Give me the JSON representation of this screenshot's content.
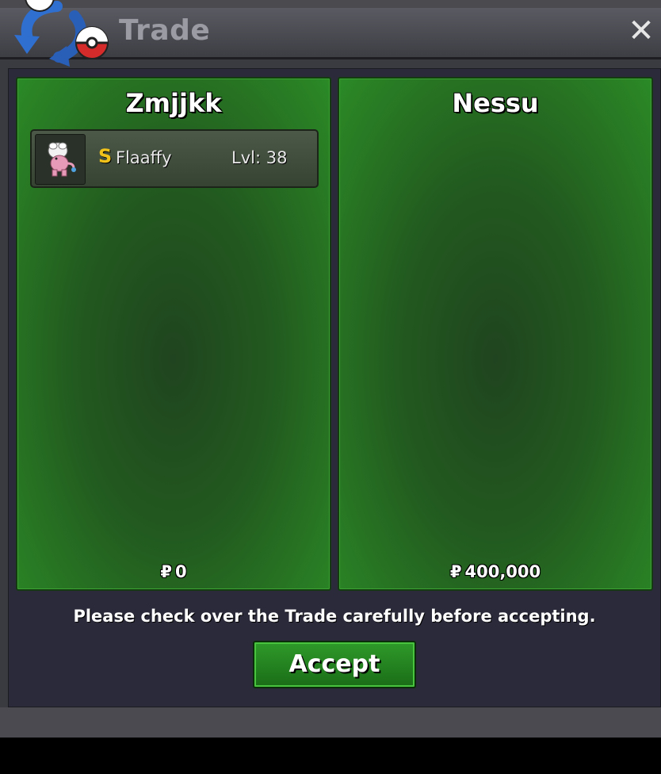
{
  "window": {
    "title": "Trade",
    "close_label": "✕"
  },
  "trade": {
    "left": {
      "player": "Zmjjkk",
      "pokemon": [
        {
          "shiny_badge": "S",
          "name": "Flaaffy",
          "level": "Lvl: 38",
          "icon": "flaaffy-sprite-icon"
        }
      ],
      "currency_symbol": "₽",
      "money": "0"
    },
    "right": {
      "player": "Nessu",
      "pokemon": [],
      "currency_symbol": "₽",
      "money": "400,000"
    },
    "notice": "Please check over the Trade carefully before accepting.",
    "accept_label": "Accept"
  },
  "colors": {
    "panel_green": "#225a1f",
    "accent_green": "#2f9a2a",
    "shiny_gold": "#f0c21a"
  }
}
